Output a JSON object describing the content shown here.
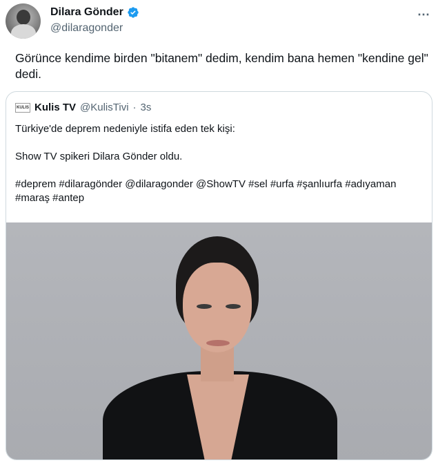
{
  "author": {
    "display_name": "Dilara Gönder",
    "handle": "@dilaragonder",
    "verified": true,
    "avatar_icon": "avatar-photo"
  },
  "more_icon": "⋯",
  "tweet": {
    "text": "Görünce kendime birden \"bitanem\" dedim, kendim bana hemen \"kendine gel\" dedi."
  },
  "quoted": {
    "logo_text": "KULIS",
    "name": "Kulis TV",
    "handle": "@KulisTivi",
    "dot": "·",
    "time": "3s",
    "text": "Türkiye'de deprem nedeniyle istifa eden tek kişi:\n\nShow TV spikeri Dilara Gönder oldu.\n\n#deprem #dilaragönder @dilaragonder @ShowTV #sel #urfa #şanlıurfa #adıyaman #maraş #antep"
  },
  "colors": {
    "text": "#0f1419",
    "secondary": "#536471",
    "verified_blue": "#1d9bf0",
    "border": "#cfd9de"
  }
}
